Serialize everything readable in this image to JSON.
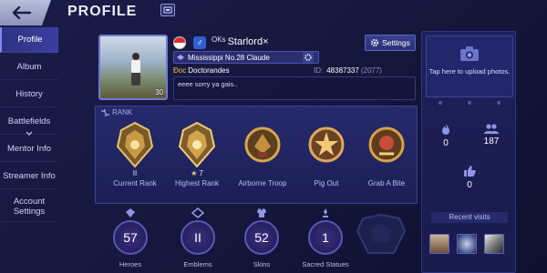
{
  "header": {
    "title": "PROFILE"
  },
  "sidebar": {
    "items": [
      {
        "label": "Profile",
        "active": true
      },
      {
        "label": "Album",
        "active": false
      },
      {
        "label": "History",
        "active": false
      },
      {
        "label": "Battlefields",
        "active": false
      },
      {
        "label": "Mentor Info",
        "active": false
      },
      {
        "label": "Streamer Info",
        "active": false
      },
      {
        "label": "Account Settings",
        "active": false
      }
    ]
  },
  "profile": {
    "avatar_level": "30",
    "squad_tag": "OKs",
    "name": "Starlord×",
    "title_text": "Mississippi No.28 Claude",
    "occupation_prefix": "Đoc",
    "occupation_name": "Doctorandes",
    "id_label": "ID:",
    "id_value": "48387337",
    "id_server": "(2077)",
    "bio": "eeee sorry ya gais..",
    "settings_label": "Settings"
  },
  "rank": {
    "header": "RANK",
    "badges": [
      {
        "sub": "II",
        "label": "Current Rank",
        "color": "#e9c46a"
      },
      {
        "sub": "7",
        "label": "Highest Rank",
        "color": "#f1cf7a",
        "star": true
      },
      {
        "sub": "",
        "label": "Airborne Troop",
        "color": "#d8a64e"
      },
      {
        "sub": "",
        "label": "Pig Out",
        "color": "#e0a85c"
      },
      {
        "sub": "",
        "label": "Grab A Bite",
        "color": "#d6a247"
      }
    ]
  },
  "stats": [
    {
      "value": "57",
      "label": "Heroes"
    },
    {
      "value": "II",
      "label": "Emblems"
    },
    {
      "value": "52",
      "label": "Skins"
    },
    {
      "value": "1",
      "label": "Sacred Statues"
    }
  ],
  "right_panel": {
    "upload_text": "Tap here to upload photos.",
    "likes_value": "0",
    "followers_value": "187",
    "thumbs_value": "0",
    "recent_visits_label": "Recent visits"
  },
  "colors": {
    "accent": "#7f8cff",
    "gold": "#e9c46a",
    "panel": "#262a6c"
  }
}
